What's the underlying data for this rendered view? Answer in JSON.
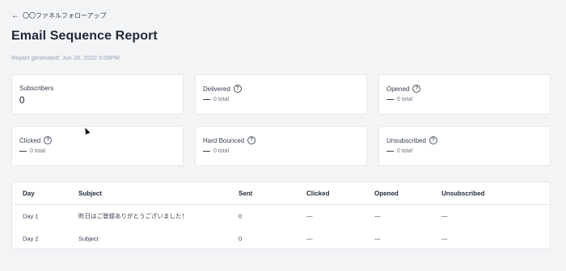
{
  "nav": {
    "back_label": "〇〇ファネルフォローアップ",
    "back_icon": "arrow-left-icon"
  },
  "page": {
    "title": "Email Sequence Report",
    "generated": "Report generated: Jun 26, 2022 5:09PM"
  },
  "stats": {
    "subscribers": {
      "label": "Subscribers",
      "value": "0"
    },
    "delivered": {
      "label": "Delivered",
      "help": "?",
      "dash": "—",
      "total": "0 total"
    },
    "opened": {
      "label": "Opened",
      "help": "?",
      "dash": "—",
      "total": "0 total"
    },
    "clicked": {
      "label": "Clicked",
      "help": "?",
      "dash": "—",
      "total": "0 total"
    },
    "hard_bounced": {
      "label": "Hard Bounced",
      "help": "?",
      "dash": "—",
      "total": "0 total"
    },
    "unsubscribed": {
      "label": "Unsubscribed",
      "help": "?",
      "dash": "—",
      "total": "0 total"
    }
  },
  "table": {
    "headers": [
      "Day",
      "Subject",
      "Sent",
      "Clicked",
      "Opened",
      "Unsubscribed"
    ],
    "rows": [
      [
        "Day 1",
        "昨日はご登録ありがとうございました！",
        "0",
        "—",
        "—",
        "—"
      ],
      [
        "Day 2",
        "Subject",
        "0",
        "—",
        "—",
        "—"
      ]
    ]
  }
}
